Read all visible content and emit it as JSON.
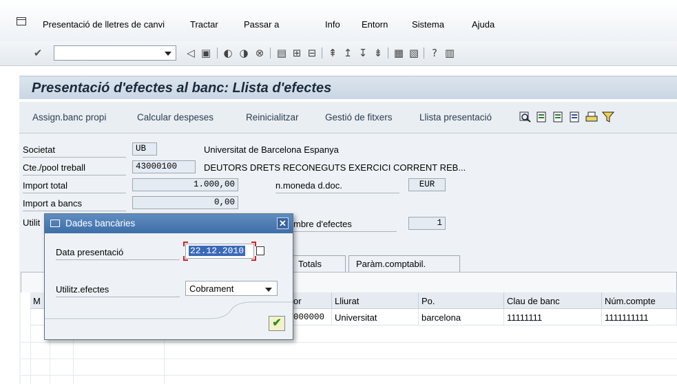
{
  "menu": {
    "items": [
      "Presentació de lletres de canvi",
      "Tractar",
      "Passar a",
      "Info",
      "Entorn",
      "Sistema",
      "Ajuda"
    ]
  },
  "command_field": {
    "value": ""
  },
  "title": "Presentació d'efectes al banc: Llista d'efectes",
  "app_toolbar": {
    "buttons": [
      "Assign.banc propi",
      "Calcular despeses",
      "Reinicialitzar",
      "Gestió de fitxers",
      "Llista presentació"
    ]
  },
  "form": {
    "societat_label": "Societat",
    "societat_value": "UB",
    "societat_desc": "Universitat de Barcelona Espanya",
    "cte_label": "Cte./pool treball",
    "cte_value": "43000100",
    "cte_desc": "DEUTORS DRETS RECONEGUTS EXERCICI CORRENT REB...",
    "import_total_label": "Import total",
    "import_total_value": "1.000,00",
    "moneda_label": "n.moneda d.doc.",
    "moneda_value": "EUR",
    "import_bancs_label": "Import a bancs",
    "import_bancs_value": "0,00",
    "utilit_label": "Utilit",
    "nombre_label": "mbre d'efectes",
    "nombre_value": "1"
  },
  "tabs": [
    "Totals",
    "Paràm.comptabil."
  ],
  "table": {
    "headers": [
      "M",
      "or",
      "Lliurat",
      "Po.",
      "Clau de banc",
      "Núm.compte"
    ],
    "row": [
      "",
      "000000",
      "Universitat",
      "barcelona",
      "11111111",
      "1111111111"
    ]
  },
  "dialog": {
    "title": "Dades bancàries",
    "date_label": "Data presentació",
    "date_value": "22.12.2010",
    "util_label": "Utilitz.efectes",
    "util_value": "Cobrament"
  }
}
